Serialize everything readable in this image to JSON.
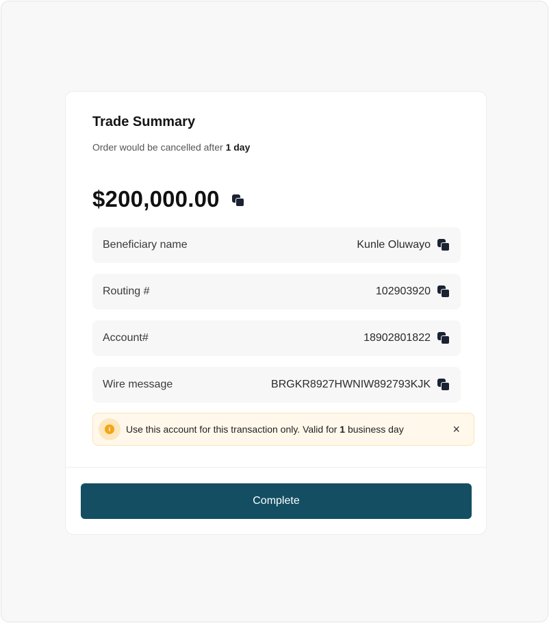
{
  "header": {
    "title": "Trade Summary",
    "subtitle_prefix": "Order would be cancelled after ",
    "subtitle_emphasis": "1 day"
  },
  "amount": "$200,000.00",
  "details": [
    {
      "label": "Beneficiary name",
      "value": "Kunle Oluwayo"
    },
    {
      "label": "Routing #",
      "value": "102903920"
    },
    {
      "label": "Account#",
      "value": "18902801822"
    },
    {
      "label": "Wire message",
      "value": "BRGKR8927HWNIW892793KJK"
    }
  ],
  "alert": {
    "icon_text": "i",
    "text_prefix": "Use this account for this transaction only. Valid for ",
    "text_emphasis": "1",
    "text_suffix": " business day",
    "close_glyph": "×"
  },
  "actions": {
    "complete_label": "Complete"
  },
  "colors": {
    "primary": "#134e63",
    "alert_bg": "#fff8eb",
    "alert_icon": "#f2a516",
    "row_bg": "#f7f7f7"
  },
  "icons": [
    "copy-icon",
    "info-icon",
    "close-icon"
  ]
}
